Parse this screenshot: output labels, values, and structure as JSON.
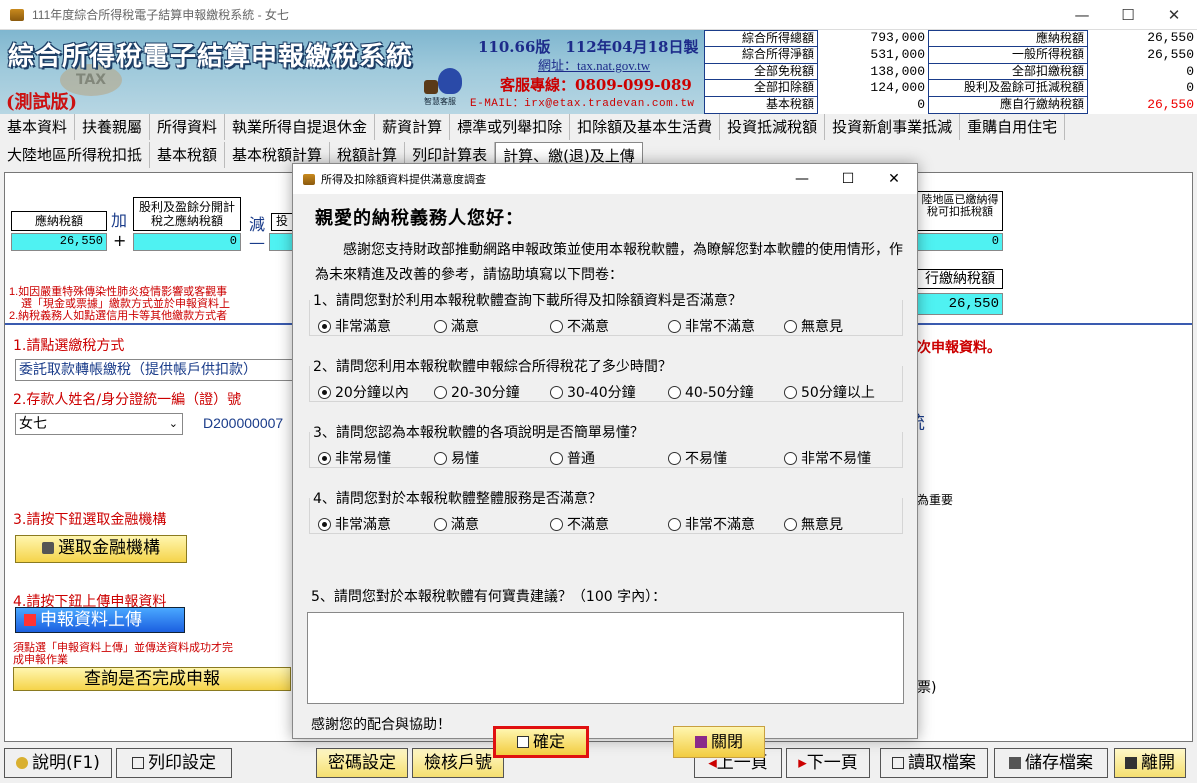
{
  "window": {
    "title": "111年度綜合所得稅電子結算申報繳稅系統 - 女七",
    "min": "—",
    "max": "☐",
    "close": "✕"
  },
  "banner": {
    "title": "綜合所得稅電子結算申報繳稅系統",
    "test": "(測試版)",
    "version": "110.66版　112年04月18日製",
    "url": "網址：tax.nat.gov.tw",
    "hotline": "客服專線：0809-099-089",
    "email": "E-MAIL：irx@etax.tradevan.com.tw",
    "mascot": "智慧客服",
    "watermark": "TAX"
  },
  "summary_left": [
    {
      "label": "綜合所得總額",
      "value": "793,000"
    },
    {
      "label": "綜合所得淨額",
      "value": "531,000"
    },
    {
      "label": "全部免稅額",
      "value": "138,000"
    },
    {
      "label": "全部扣除額",
      "value": "124,000"
    },
    {
      "label": "基本稅額",
      "value": "0"
    }
  ],
  "summary_right": [
    {
      "label": "應納稅額",
      "value": "26,550"
    },
    {
      "label": "一般所得稅額",
      "value": "26,550"
    },
    {
      "label": "全部扣繳稅額",
      "value": "0"
    },
    {
      "label": "股利及盈餘可抵減稅額",
      "value": "0"
    },
    {
      "label": "應自行繳納稅額",
      "value": "26,550"
    }
  ],
  "menu1": [
    "基本資料",
    "扶養親屬",
    "所得資料",
    "執業所得自提退休金",
    "薪資計算",
    "標準或列舉扣除",
    "扣除額及基本生活費",
    "投資抵減稅額",
    "投資新創事業抵減",
    "重購自用住宅"
  ],
  "menu2": [
    "大陸地區所得稅扣抵",
    "基本稅額",
    "基本稅額計算",
    "稅額計算",
    "列印計算表",
    "計算、繳(退)及上傳"
  ],
  "calc": {
    "b1_label": "應納稅額",
    "b1_value": "26,550",
    "plus_text": "加",
    "plus_sign": "+",
    "b2_label": "股利及盈餘分開計稅之應納稅額",
    "b2_value": "0",
    "minus_text": "減",
    "minus_sign": "—",
    "b3_label": "投",
    "b4_label": "陸地區已繳納得稅可扣抵稅額",
    "b4_value": "0",
    "b5_label": "行繳納稅額",
    "b5_value": "26,550",
    "note1": "1.如因嚴重特殊傳染性肺炎疫情影響或客觀事",
    "note1b": "選「現金或票據」繳款方式並於申報資料上",
    "note2": "2.納稅義務人如點選信用卡等其他繳款方式者"
  },
  "left": {
    "step1": "1.請點選繳稅方式",
    "pay_method": "委託取款轉帳繳稅（提供帳戶供扣款）",
    "step2": "2.存款人姓名/身分證統一編（證）號",
    "name": "女七",
    "id": "D200000007",
    "step3": "3.請按下鈕選取金融機構",
    "bank_btn": "選取金融機構",
    "step4": "4.請按下鈕上傳申報資料",
    "upload_btn": "申報資料上傳",
    "note3": "須點選「申報資料上傳」並傳送資料成功才完",
    "note3b": "成申報作業",
    "query_btn": "查詢是否完成申報"
  },
  "right": {
    "red": "次申報資料。",
    "imp": "為重要",
    "ticket": "票)",
    "blue": "統"
  },
  "bottom": [
    "說明(F1)",
    "列印設定",
    "密碼設定",
    "檢核戶號",
    "上一頁",
    "下一頁",
    "讀取檔案",
    "儲存檔案",
    "離開"
  ],
  "dialog": {
    "title": "所得及扣除額資料提供滿意度調查",
    "heading": "親愛的納稅義務人您好：",
    "intro": "感謝您支持財政部推動網路申報政策並使用本報稅軟體，為瞭解您對本軟體的使用情形，作為未來精進及改善的參考，請協助填寫以下問卷：",
    "questions": [
      {
        "q": "1、請問您對於利用本報稅軟體查詢下載所得及扣除額資料是否滿意？",
        "options": [
          "非常滿意",
          "滿意",
          "不滿意",
          "非常不滿意",
          "無意見"
        ],
        "selected": 0
      },
      {
        "q": "2、請問您利用本報稅軟體申報綜合所得稅花了多少時間？",
        "options": [
          "20分鐘以內",
          "20-30分鐘",
          "30-40分鐘",
          "40-50分鐘",
          "50分鐘以上"
        ],
        "selected": 0
      },
      {
        "q": "3、請問您認為本報稅軟體的各項說明是否簡單易懂？",
        "options": [
          "非常易懂",
          "易懂",
          "普通",
          "不易懂",
          "非常不易懂"
        ],
        "selected": 0
      },
      {
        "q": "4、請問您對於本報稅軟體整體服務是否滿意？",
        "options": [
          "非常滿意",
          "滿意",
          "不滿意",
          "非常不滿意",
          "無意見"
        ],
        "selected": 0
      }
    ],
    "q5": "5、請問您對於本報稅軟體有何寶貴建議？（100 字內）：",
    "thanks": "感謝您的配合與協助！",
    "ok": "確定",
    "close": "關閉"
  }
}
